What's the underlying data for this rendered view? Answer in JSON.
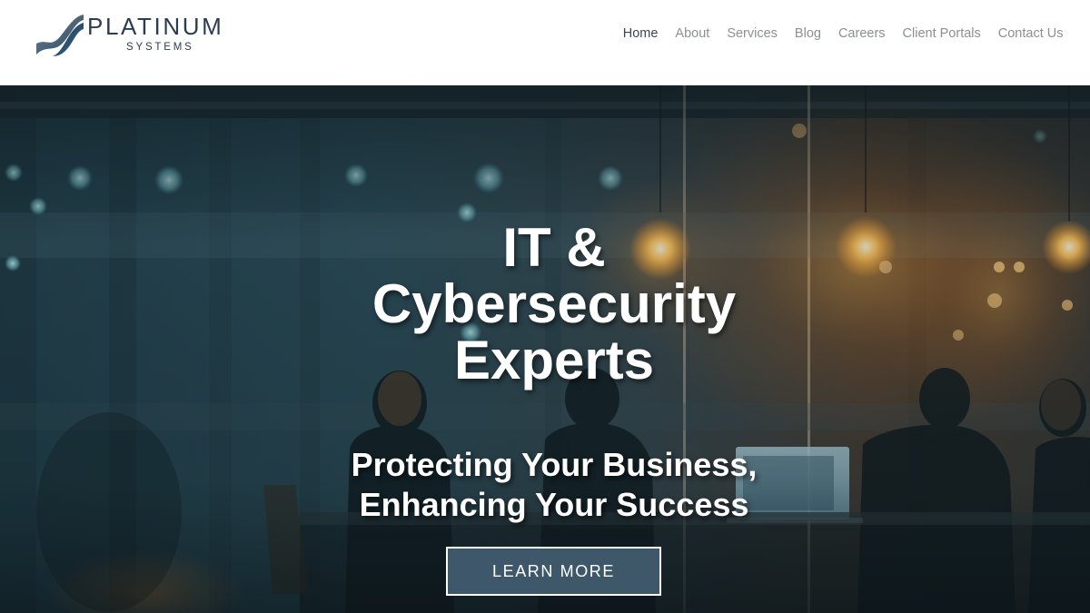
{
  "header": {
    "logo": {
      "word": "PLATINUM",
      "sub": "SYSTEMS"
    },
    "nav": [
      {
        "label": "Home",
        "active": true
      },
      {
        "label": "About"
      },
      {
        "label": "Services"
      },
      {
        "label": "Blog"
      },
      {
        "label": "Careers"
      },
      {
        "label": "Client Portals"
      },
      {
        "label": "Contact Us"
      }
    ]
  },
  "hero": {
    "title_lines": [
      "IT &",
      "Cybersecurity",
      "Experts"
    ],
    "subtitle_lines": [
      "Protecting Your Business,",
      "Enhancing Your Success"
    ],
    "cta_label": "LEARN MORE"
  },
  "colors": {
    "brand_navy": "#2c3d52",
    "nav_text": "#8b8f96",
    "nav_active": "#3a4656",
    "cta_bg": "#425c70"
  }
}
